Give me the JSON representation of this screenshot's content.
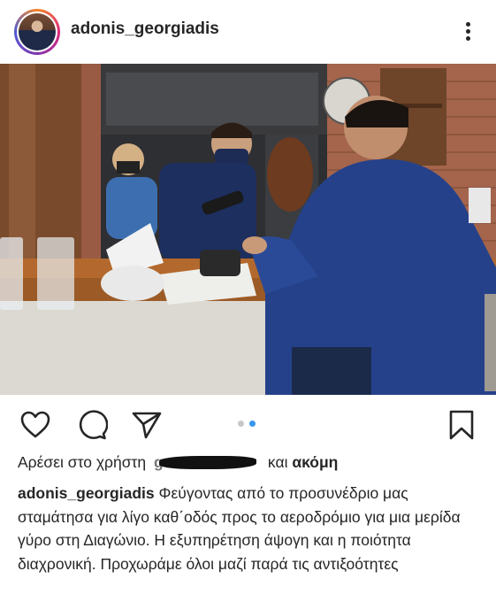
{
  "post": {
    "username": "adonis_georgiadis",
    "menu_icon": "more-vertical-icon"
  },
  "actions": {
    "like_icon": "heart-icon",
    "comment_icon": "comment-icon",
    "share_icon": "send-icon",
    "save_icon": "bookmark-icon",
    "carousel": {
      "count": 2,
      "active_index": 2
    }
  },
  "likes": {
    "prefix": "Αρέσει στο χρήστη",
    "redacted_user": "g        s",
    "suffix_plain": "και",
    "suffix_bold": "ακόμη"
  },
  "caption": {
    "username": "adonis_georgiadis",
    "text": "Φεύγοντας από το προσυνέδριο μας σταμάτησα για λίγο καθ΄οδός προς το αεροδρόμιο για μια μερίδα γύρο στη Διαγώνιο. Η εξυπηρέτηση άψογη και η ποιότητα διαχρονική. Προχωράμε όλοι μαζί παρά τις αντιξοότητες"
  },
  "colors": {
    "text": "#262626",
    "carousel_active": "#3897f0",
    "carousel_inactive": "#c7c7c7"
  }
}
